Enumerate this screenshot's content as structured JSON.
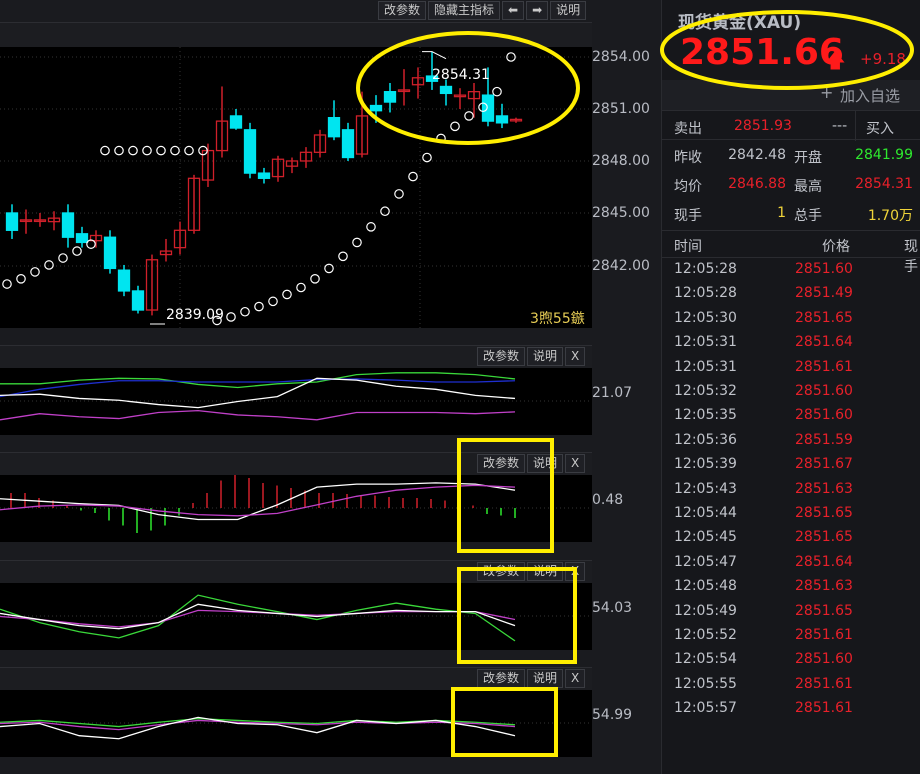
{
  "toolbar": {
    "buttons": [
      "改参数",
      "隐藏主指标",
      "⬅",
      "➡",
      "说明"
    ]
  },
  "main_chart": {
    "price_axis": [
      "2854.00",
      "2851.00",
      "2848.00",
      "2845.00",
      "2842.00"
    ],
    "high_label": "2854.31",
    "low_label": "2839.09",
    "countdown": "3煦55鏃",
    "colors": {
      "up": "#d0202a",
      "down": "#00e5f0",
      "sar": "#ffffff"
    }
  },
  "chart_data": {
    "type": "candlestick",
    "ylim": [
      2838.6,
      2854.6
    ],
    "candles": [
      [
        2845.0,
        2845.5,
        2843.5,
        2844.0
      ],
      [
        2844.6,
        2845.2,
        2843.8,
        2844.6
      ],
      [
        2844.6,
        2845.0,
        2844.2,
        2844.6
      ],
      [
        2844.5,
        2845.1,
        2844.0,
        2844.7
      ],
      [
        2845.0,
        2845.5,
        2843.0,
        2843.6
      ],
      [
        2843.8,
        2844.2,
        2843.0,
        2843.3
      ],
      [
        2843.4,
        2844.0,
        2843.0,
        2843.7
      ],
      [
        2843.6,
        2844.0,
        2841.5,
        2841.8
      ],
      [
        2841.7,
        2842.0,
        2840.2,
        2840.5
      ],
      [
        2840.5,
        2840.8,
        2839.2,
        2839.4
      ],
      [
        2839.4,
        2842.6,
        2839.09,
        2842.3
      ],
      [
        2842.6,
        2843.5,
        2842.2,
        2842.8
      ],
      [
        2843.0,
        2844.5,
        2842.6,
        2844.0
      ],
      [
        2844.0,
        2847.2,
        2843.8,
        2847.0
      ],
      [
        2846.9,
        2849.0,
        2846.5,
        2848.6
      ],
      [
        2848.6,
        2852.3,
        2848.2,
        2850.3
      ],
      [
        2850.6,
        2851.0,
        2849.8,
        2849.9
      ],
      [
        2849.8,
        2850.2,
        2847.0,
        2847.3
      ],
      [
        2847.3,
        2847.6,
        2846.7,
        2847.0
      ],
      [
        2847.1,
        2848.3,
        2846.8,
        2848.1
      ],
      [
        2847.7,
        2848.2,
        2847.3,
        2848.0
      ],
      [
        2848.0,
        2848.8,
        2847.6,
        2848.5
      ],
      [
        2848.5,
        2849.8,
        2848.2,
        2849.5
      ],
      [
        2850.5,
        2851.5,
        2849.2,
        2849.4
      ],
      [
        2849.8,
        2850.2,
        2848.0,
        2848.2
      ],
      [
        2848.4,
        2852.0,
        2848.2,
        2850.6
      ],
      [
        2851.2,
        2851.8,
        2850.2,
        2850.9
      ],
      [
        2852.0,
        2852.5,
        2850.8,
        2851.4
      ],
      [
        2852.1,
        2853.3,
        2851.2,
        2852.1
      ],
      [
        2852.4,
        2853.4,
        2851.6,
        2852.8
      ],
      [
        2852.9,
        2854.31,
        2852.1,
        2852.6
      ],
      [
        2852.3,
        2852.7,
        2851.2,
        2851.9
      ],
      [
        2851.8,
        2852.2,
        2851.0,
        2851.8
      ],
      [
        2851.6,
        2852.5,
        2850.5,
        2852.0
      ],
      [
        2851.8,
        2853.4,
        2850.0,
        2850.3
      ],
      [
        2850.6,
        2851.3,
        2849.9,
        2850.2
      ],
      [
        2850.4,
        2850.5,
        2850.2,
        2850.4
      ]
    ],
    "sar": [
      2840.9,
      2841.2,
      2841.6,
      2842.0,
      2842.4,
      2842.8,
      2843.2,
      2848.6,
      2848.6,
      2848.6,
      2848.6,
      2848.6,
      2848.6,
      2848.6,
      2848.6,
      2838.8,
      2839.0,
      2839.3,
      2839.6,
      2839.9,
      2840.3,
      2840.7,
      2841.2,
      2841.8,
      2842.5,
      2843.3,
      2844.2,
      2845.1,
      2846.1,
      2847.1,
      2848.2,
      2849.3,
      2850.0,
      2850.6,
      2851.1,
      2852.0,
      2854.0
    ],
    "subpanels": [
      {
        "value_label": "21.07",
        "buttons": [
          "改参数",
          "说明",
          "X"
        ],
        "series": [
          {
            "color": "#3ad83a",
            "values": [
              79,
              79,
              85,
              88,
              87,
              78,
              73,
              79,
              82,
              94,
              97,
              97,
              94,
              87
            ]
          },
          {
            "color": "#1f2fd0",
            "values": [
              58,
              70,
              78,
              84,
              84,
              82,
              82,
              82,
              86,
              87,
              85,
              82,
              82,
              84
            ]
          },
          {
            "color": "#ffffff",
            "values": [
              60,
              62,
              55,
              52,
              45,
              40,
              50,
              58,
              88,
              85,
              75,
              70,
              60,
              55
            ]
          },
          {
            "color": "#c040c8",
            "values": [
              20,
              30,
              25,
              22,
              32,
              35,
              28,
              25,
              20,
              32,
              32,
              32,
              30,
              33
            ]
          }
        ]
      },
      {
        "value_label": "0.48",
        "buttons": [
          "改参数",
          "说明",
          "X"
        ],
        "histogram": [
          0.3,
          0.3,
          0.2,
          0.15,
          0.05,
          -0.05,
          -0.1,
          -0.25,
          -0.35,
          -0.5,
          -0.45,
          -0.35,
          -0.15,
          0.1,
          0.3,
          0.55,
          0.7,
          0.6,
          0.5,
          0.45,
          0.4,
          0.35,
          0.3,
          0.3,
          0.28,
          0.25,
          0.25,
          0.22,
          0.2,
          0.2,
          0.18,
          0.15,
          0.1,
          0.05,
          -0.12,
          -0.15,
          -0.2
        ],
        "series": [
          {
            "color": "#ffffff",
            "values": [
              66,
              62,
              58,
              55,
              40,
              32,
              32,
              56,
              85,
              90,
              90,
              92,
              90,
              80
            ]
          },
          {
            "color": "#c040c8",
            "values": [
              48,
              54,
              56,
              54,
              46,
              40,
              38,
              42,
              56,
              70,
              80,
              85,
              88,
              85
            ]
          }
        ]
      },
      {
        "value_label": "54.03",
        "buttons": [
          "改参数",
          "说明",
          "X"
        ],
        "series": [
          {
            "color": "#3ad83a",
            "values": [
              62,
              40,
              25,
              15,
              35,
              85,
              70,
              58,
              45,
              60,
              72,
              62,
              55,
              10
            ]
          },
          {
            "color": "#c040c8",
            "values": [
              50,
              45,
              38,
              33,
              40,
              60,
              58,
              55,
              52,
              55,
              58,
              58,
              58,
              45
            ]
          },
          {
            "color": "#ffffff",
            "values": [
              55,
              45,
              35,
              30,
              40,
              70,
              60,
              55,
              50,
              55,
              60,
              58,
              58,
              35
            ]
          }
        ]
      },
      {
        "value_label": "54.99",
        "buttons": [
          "改参数",
          "说明",
          "X"
        ],
        "series": [
          {
            "color": "#3ad83a",
            "values": [
              52,
              55,
              50,
              45,
              52,
              58,
              55,
              52,
              50,
              55,
              52,
              55,
              52,
              48
            ]
          },
          {
            "color": "#c040c8",
            "values": [
              50,
              52,
              45,
              40,
              48,
              55,
              52,
              50,
              48,
              52,
              50,
              52,
              50,
              45
            ]
          },
          {
            "color": "#ffffff",
            "values": [
              45,
              50,
              30,
              25,
              45,
              60,
              50,
              48,
              35,
              55,
              50,
              55,
              45,
              30
            ]
          }
        ]
      }
    ]
  },
  "quote": {
    "title": "现货黄金(XAU)",
    "price": "2851.66",
    "change": "+9.18",
    "add_watch": "加入自选",
    "sell_label": "卖出",
    "sell_value": "2851.93",
    "dash": "---",
    "buy_label": "买入",
    "stats": [
      {
        "l1": "昨收",
        "v1": "2842.48",
        "l2": "开盘",
        "v2": "2841.99"
      },
      {
        "l1": "均价",
        "v1": "2846.88",
        "l2": "最高",
        "v2": "2854.31"
      },
      {
        "l1": "现手",
        "v1": "1",
        "l2": "总手",
        "v2": "1.70万"
      }
    ],
    "tick_headers": [
      "时间",
      "价格",
      "现手"
    ],
    "ticks": [
      [
        "12:05:28",
        "2851.60"
      ],
      [
        "12:05:28",
        "2851.49"
      ],
      [
        "12:05:30",
        "2851.65"
      ],
      [
        "12:05:31",
        "2851.64"
      ],
      [
        "12:05:31",
        "2851.61"
      ],
      [
        "12:05:32",
        "2851.60"
      ],
      [
        "12:05:35",
        "2851.60"
      ],
      [
        "12:05:36",
        "2851.59"
      ],
      [
        "12:05:39",
        "2851.67"
      ],
      [
        "12:05:43",
        "2851.63"
      ],
      [
        "12:05:44",
        "2851.65"
      ],
      [
        "12:05:45",
        "2851.65"
      ],
      [
        "12:05:47",
        "2851.64"
      ],
      [
        "12:05:48",
        "2851.63"
      ],
      [
        "12:05:49",
        "2851.65"
      ],
      [
        "12:05:52",
        "2851.61"
      ],
      [
        "12:05:54",
        "2851.60"
      ],
      [
        "12:05:55",
        "2851.61"
      ],
      [
        "12:05:57",
        "2851.61"
      ]
    ]
  }
}
